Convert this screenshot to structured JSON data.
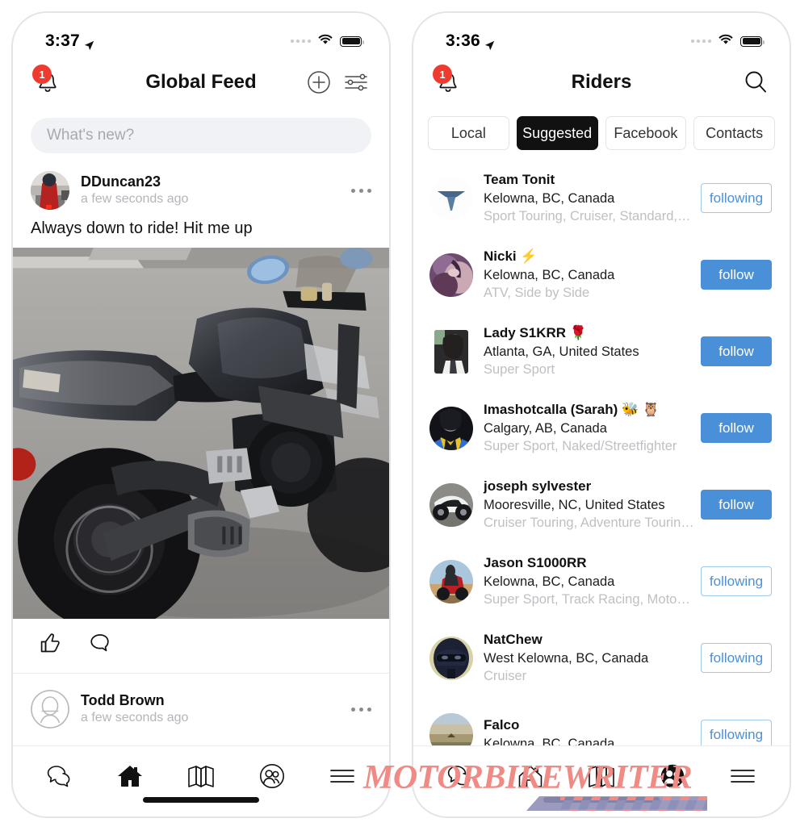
{
  "app": {
    "accent_blue": "#4a90d9",
    "badge_red": "#ed3b2f",
    "watermark_pink": "#f08a84"
  },
  "left_phone": {
    "status": {
      "time": "3:37",
      "location_icon": "location-arrow-icon",
      "wifi_icon": "wifi-icon",
      "battery_icon": "battery-icon"
    },
    "header": {
      "title": "Global Feed",
      "bell_icon": "notification-bell-icon",
      "badge_count": "1",
      "add_icon": "plus-circle-icon",
      "filter_icon": "sliders-filter-icon"
    },
    "composer": {
      "placeholder": "What's new?",
      "value": ""
    },
    "posts": [
      {
        "user": "DDuncan23",
        "time": "a few seconds ago",
        "text": "Always down to ride! Hit me up",
        "avatar_icon": "rider-photo-avatar",
        "more_icon": "more-options-icon",
        "photo_alt": "motorcycle-photo",
        "like_icon": "thumbs-up-icon",
        "comment_icon": "comment-bubble-icon"
      },
      {
        "user": "Todd Brown",
        "time": "a few seconds ago",
        "avatar_icon": "default-person-avatar",
        "more_icon": "more-options-icon"
      }
    ],
    "tabbar": [
      {
        "name": "messages",
        "icon": "chat-bubbles-icon",
        "active": false
      },
      {
        "name": "feed",
        "icon": "home-icon",
        "active": true
      },
      {
        "name": "map",
        "icon": "map-icon",
        "active": false
      },
      {
        "name": "riders",
        "icon": "people-circle-icon",
        "active": false
      },
      {
        "name": "menu",
        "icon": "hamburger-menu-icon",
        "active": false
      }
    ]
  },
  "right_phone": {
    "status": {
      "time": "3:36",
      "location_icon": "location-arrow-icon",
      "wifi_icon": "wifi-icon",
      "battery_icon": "battery-icon"
    },
    "header": {
      "title": "Riders",
      "bell_icon": "notification-bell-icon",
      "badge_count": "1",
      "search_icon": "search-icon"
    },
    "segments": [
      {
        "label": "Local",
        "active": false
      },
      {
        "label": "Suggested",
        "active": true
      },
      {
        "label": "Facebook",
        "active": false
      },
      {
        "label": "Contacts",
        "active": false
      }
    ],
    "riders": [
      {
        "name": "Team Tonit",
        "location": "Kelowna, BC, Canada",
        "tags": "Sport Touring, Cruiser, Standard, Sco…",
        "button": "following",
        "state": "following",
        "avatar": "team-tonit-logo-avatar"
      },
      {
        "name": "Nicki ⚡",
        "location": "Kelowna, BC, Canada",
        "tags": "ATV, Side by Side",
        "button": "follow",
        "state": "follow",
        "avatar": "nicki-photo-avatar"
      },
      {
        "name": "Lady S1KRR 🌹",
        "location": "Atlanta, GA, United States",
        "tags": "Super Sport",
        "button": "follow",
        "state": "follow",
        "avatar": "lady-s1krr-photo-avatar"
      },
      {
        "name": "Imashotcalla (Sarah) 🐝 🦉",
        "location": "Calgary, AB, Canada",
        "tags": "Super Sport, Naked/Streetfighter",
        "button": "follow",
        "state": "follow",
        "avatar": "imashotcalla-photo-avatar"
      },
      {
        "name": "joseph sylvester",
        "location": "Mooresville, NC, United States",
        "tags": "Cruiser Touring, Adventure Touring, S…",
        "button": "follow",
        "state": "follow",
        "avatar": "joseph-sylvester-bike-avatar"
      },
      {
        "name": "Jason S1000RR",
        "location": "Kelowna, BC, Canada",
        "tags": "Super Sport, Track Racing, Motocross…",
        "button": "following",
        "state": "following",
        "avatar": "jason-s1000rr-bike-avatar"
      },
      {
        "name": "NatChew",
        "location": "West Kelowna, BC, Canada",
        "tags": "Cruiser",
        "button": "following",
        "state": "following",
        "avatar": "natchew-helmet-avatar"
      },
      {
        "name": "Falco",
        "location": "Kelowna, BC, Canada",
        "tags": "",
        "button": "following",
        "state": "following",
        "avatar": "falco-landscape-avatar"
      }
    ],
    "tabbar": [
      {
        "name": "messages",
        "icon": "chat-bubbles-icon",
        "active": false
      },
      {
        "name": "feed",
        "icon": "home-icon",
        "active": false
      },
      {
        "name": "map",
        "icon": "map-icon",
        "active": false
      },
      {
        "name": "riders",
        "icon": "people-circle-icon",
        "active": true
      },
      {
        "name": "menu",
        "icon": "hamburger-menu-icon",
        "active": false
      }
    ]
  },
  "watermark": {
    "text": "MOTORBIKEWRITER"
  }
}
